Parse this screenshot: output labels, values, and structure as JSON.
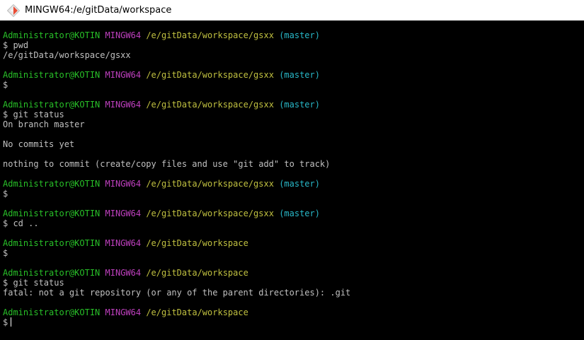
{
  "window": {
    "title": "MINGW64:/e/gitData/workspace",
    "icon": "git-icon"
  },
  "colors": {
    "user": "#28c028",
    "system": "#bf40bf",
    "path": "#c0c040",
    "branch": "#28b8c8",
    "text": "#c0c0c0",
    "background": "#000000"
  },
  "terminal": {
    "lines": [
      {
        "t": "prompt",
        "user": "Administrator@KOTIN",
        "sys": "MINGW64",
        "path": "/e/gitData/workspace/gsxx",
        "branch": "(master)"
      },
      {
        "t": "text",
        "text": "$ pwd"
      },
      {
        "t": "text",
        "text": "/e/gitData/workspace/gsxx"
      },
      {
        "t": "blank"
      },
      {
        "t": "prompt",
        "user": "Administrator@KOTIN",
        "sys": "MINGW64",
        "path": "/e/gitData/workspace/gsxx",
        "branch": "(master)"
      },
      {
        "t": "text",
        "text": "$"
      },
      {
        "t": "blank"
      },
      {
        "t": "prompt",
        "user": "Administrator@KOTIN",
        "sys": "MINGW64",
        "path": "/e/gitData/workspace/gsxx",
        "branch": "(master)"
      },
      {
        "t": "text",
        "text": "$ git status"
      },
      {
        "t": "text",
        "text": "On branch master"
      },
      {
        "t": "blank"
      },
      {
        "t": "text",
        "text": "No commits yet"
      },
      {
        "t": "blank"
      },
      {
        "t": "text",
        "text": "nothing to commit (create/copy files and use \"git add\" to track)"
      },
      {
        "t": "blank"
      },
      {
        "t": "prompt",
        "user": "Administrator@KOTIN",
        "sys": "MINGW64",
        "path": "/e/gitData/workspace/gsxx",
        "branch": "(master)"
      },
      {
        "t": "text",
        "text": "$"
      },
      {
        "t": "blank"
      },
      {
        "t": "prompt",
        "user": "Administrator@KOTIN",
        "sys": "MINGW64",
        "path": "/e/gitData/workspace/gsxx",
        "branch": "(master)"
      },
      {
        "t": "text",
        "text": "$ cd .."
      },
      {
        "t": "blank"
      },
      {
        "t": "prompt",
        "user": "Administrator@KOTIN",
        "sys": "MINGW64",
        "path": "/e/gitData/workspace",
        "branch": ""
      },
      {
        "t": "text",
        "text": "$"
      },
      {
        "t": "blank"
      },
      {
        "t": "prompt",
        "user": "Administrator@KOTIN",
        "sys": "MINGW64",
        "path": "/e/gitData/workspace",
        "branch": ""
      },
      {
        "t": "text",
        "text": "$ git status"
      },
      {
        "t": "text",
        "text": "fatal: not a git repository (or any of the parent directories): .git"
      },
      {
        "t": "blank"
      },
      {
        "t": "prompt",
        "user": "Administrator@KOTIN",
        "sys": "MINGW64",
        "path": "/e/gitData/workspace",
        "branch": ""
      },
      {
        "t": "input",
        "text": "$"
      }
    ]
  }
}
